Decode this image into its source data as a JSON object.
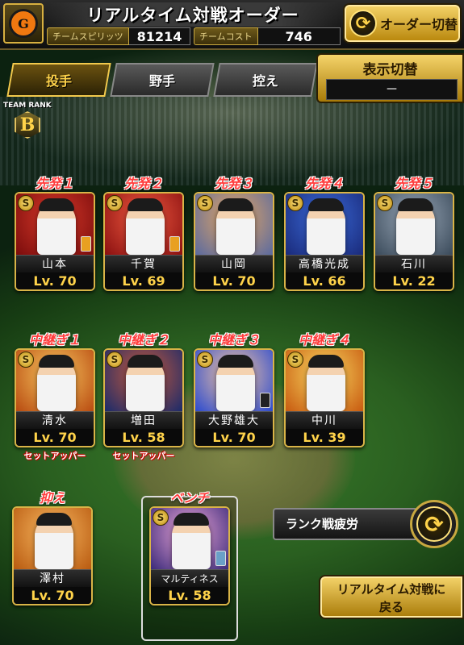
{
  "header": {
    "title": "リアルタイム対戦オーダー",
    "team_logo_letter": "G",
    "team_spirits_label": "チームスピリッツ",
    "team_spirits_value": "81214",
    "team_cost_label": "チームコスト",
    "team_cost_value": "746",
    "order_switch_label": "オーダー切替"
  },
  "tabs": [
    {
      "label": "投手",
      "active": true
    },
    {
      "label": "野手",
      "active": false
    },
    {
      "label": "控え",
      "active": false
    }
  ],
  "display_switch": {
    "label": "表示切替",
    "value": "－"
  },
  "team_rank": {
    "caption": "TEAM RANK",
    "grade": "B"
  },
  "starters": [
    {
      "role": "先発１",
      "name": "山本",
      "level": "Lv. 70",
      "coin": "S",
      "badge_color": "#e8a020",
      "art": [
        "#7a0c0c",
        "#d83a2a"
      ]
    },
    {
      "role": "先発２",
      "name": "千賀",
      "level": "Lv. 69",
      "coin": "S",
      "badge_color": "#e8a020",
      "art": [
        "#8a1010",
        "#f05a40"
      ]
    },
    {
      "role": "先発３",
      "name": "山岡",
      "level": "Lv. 70",
      "coin": "S",
      "badge_color": "",
      "art": [
        "#5a6aa0",
        "#e8a860"
      ]
    },
    {
      "role": "先発４",
      "name": "高橋光成",
      "level": "Lv. 66",
      "coin": "S",
      "badge_color": "",
      "art": [
        "#1a2a7a",
        "#3a6ad8"
      ]
    },
    {
      "role": "先発５",
      "name": "石川",
      "level": "Lv. 22",
      "coin": "S",
      "badge_color": "",
      "art": [
        "#3a4a5a",
        "#9aa8b8"
      ]
    }
  ],
  "relievers": [
    {
      "role": "中継ぎ１",
      "name": "清水",
      "level": "Lv. 70",
      "coin": "S",
      "badge_color": "",
      "subrole": "セットアッパー",
      "art": [
        "#b84a10",
        "#f8c860"
      ]
    },
    {
      "role": "中継ぎ２",
      "name": "増田",
      "level": "Lv. 58",
      "coin": "S",
      "badge_color": "",
      "subrole": "セットアッパー",
      "art": [
        "#1a2a6a",
        "#c85a3a"
      ]
    },
    {
      "role": "中継ぎ３",
      "name": "大野雄大",
      "level": "Lv. 70",
      "coin": "S",
      "badge_color": "#222222",
      "subrole": "",
      "art": [
        "#2a4ad0",
        "#f8c8a0"
      ]
    },
    {
      "role": "中継ぎ４",
      "name": "中川",
      "level": "Lv. 39",
      "coin": "S",
      "badge_color": "",
      "subrole": "",
      "art": [
        "#c85a10",
        "#f8d860"
      ]
    }
  ],
  "closer": {
    "role": "抑え",
    "name": "澤村",
    "level": "Lv. 70",
    "coin": "",
    "badge_color": "",
    "art": [
      "#b85a10",
      "#f8b860"
    ]
  },
  "bench": {
    "role": "ベンチ",
    "name": "マルティネス",
    "level": "Lv. 58",
    "coin": "S",
    "badge_color": "#6aa0c8",
    "art": [
      "#3a2a7a",
      "#f0a8d8"
    ]
  },
  "fatigue_label": "ランク戦疲労",
  "return_button": {
    "line1": "リアルタイム対戦に",
    "line2": "戻る"
  }
}
